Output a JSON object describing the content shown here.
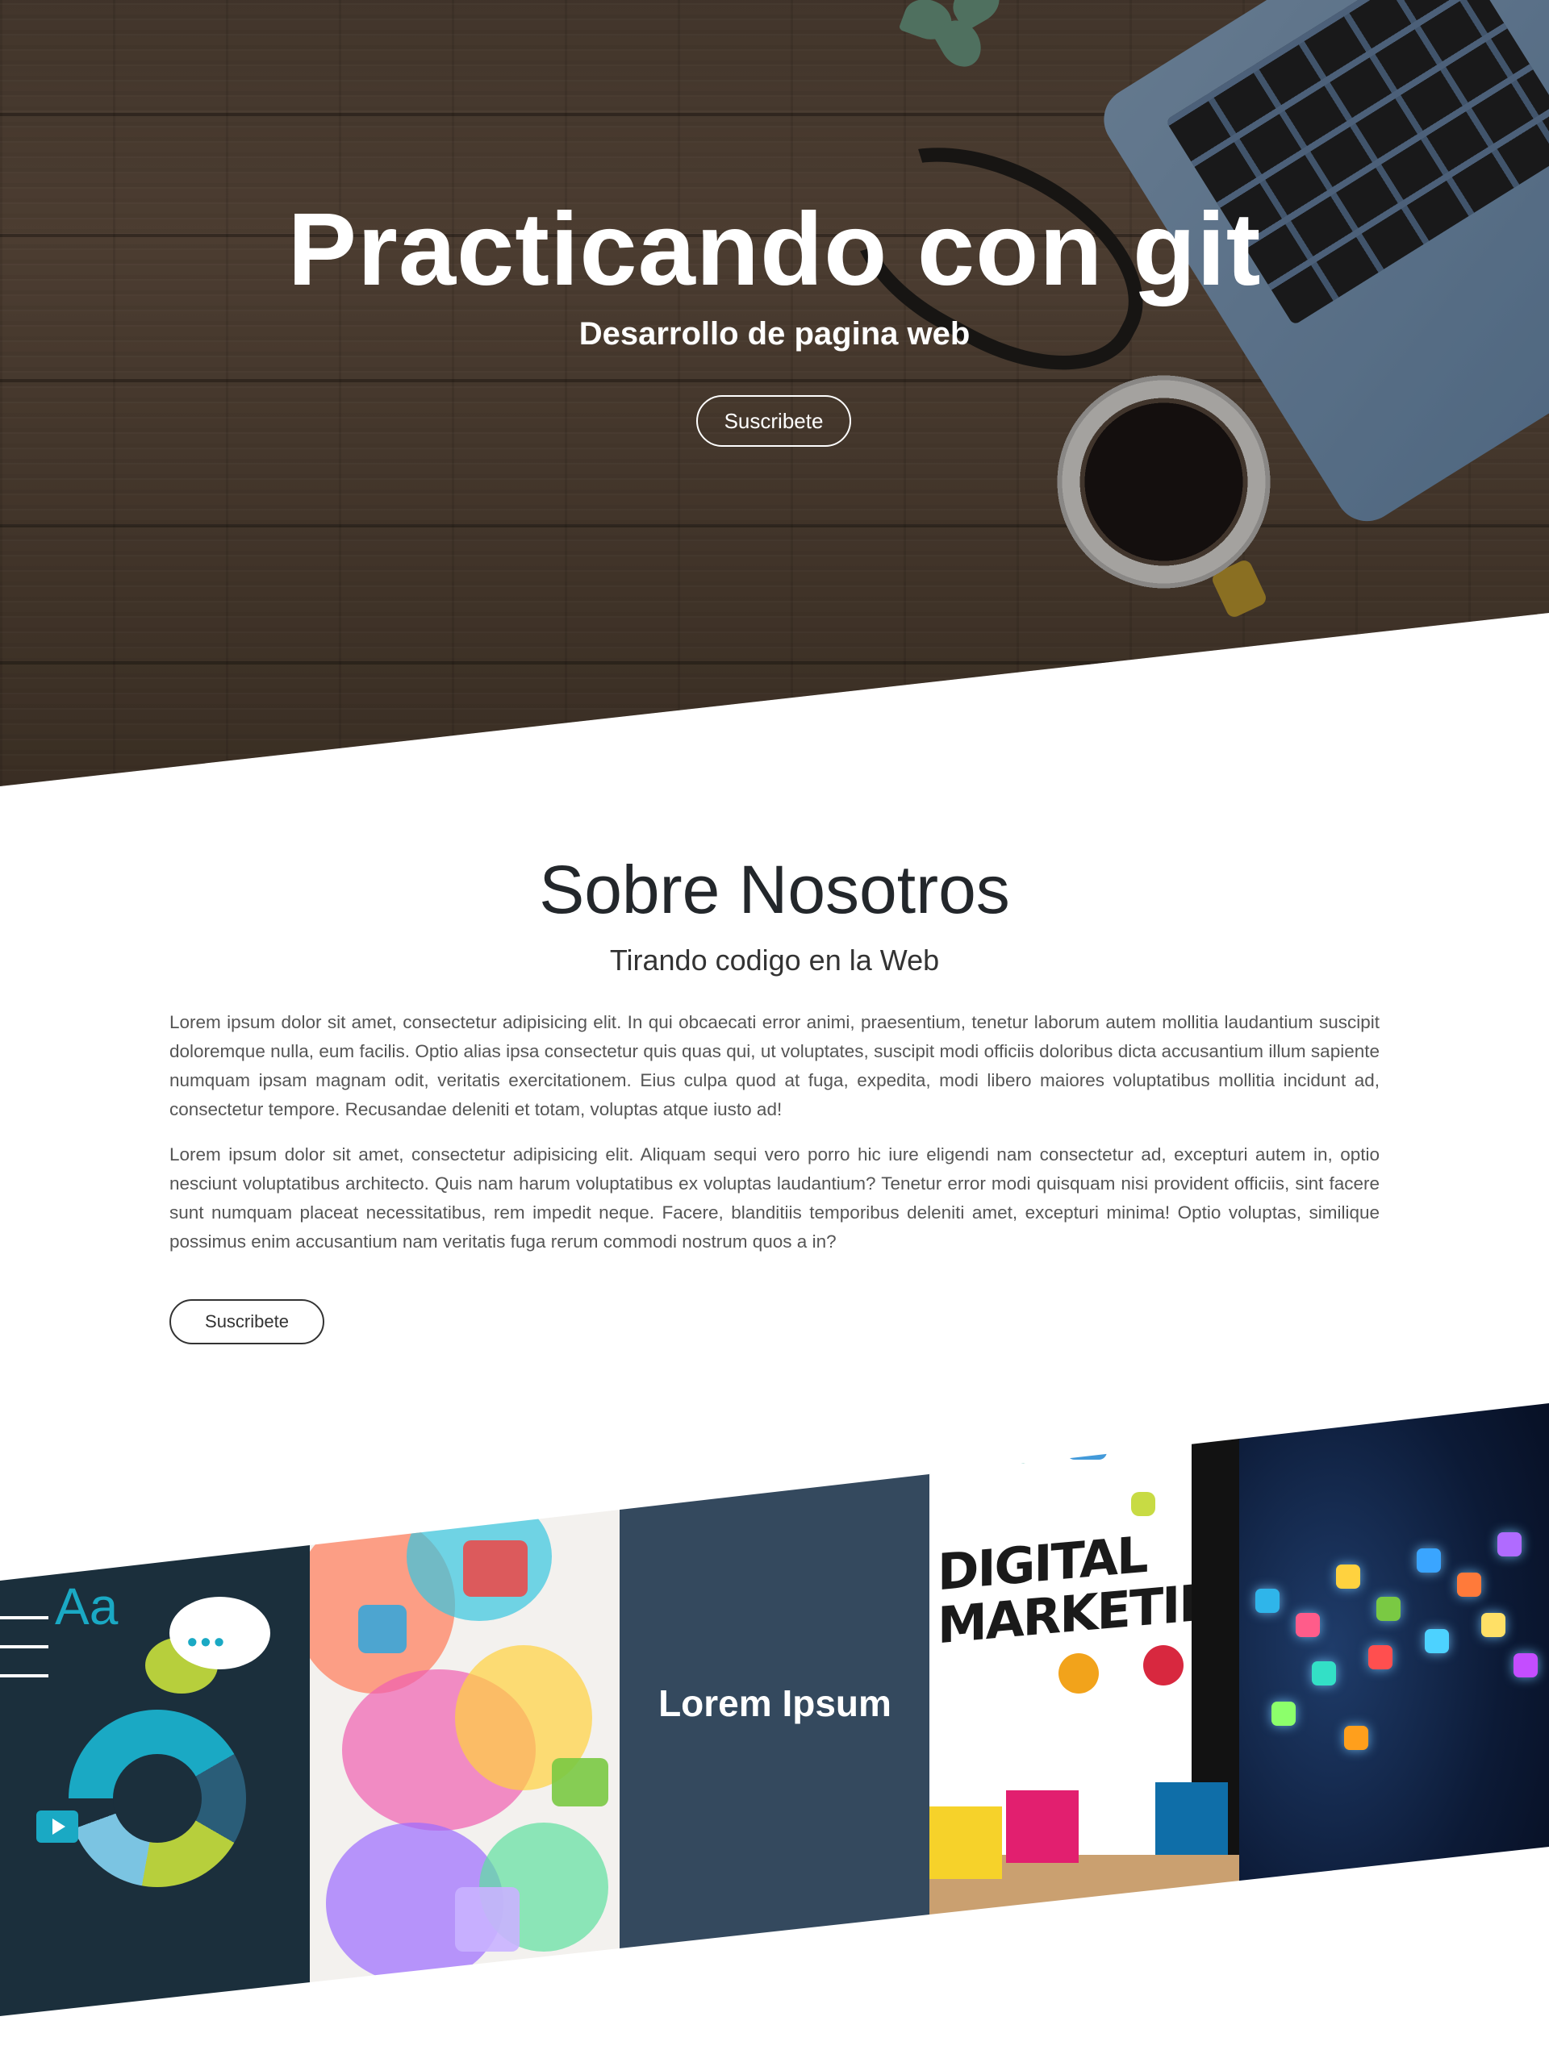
{
  "hero": {
    "title": "Practicando con git",
    "subtitle": "Desarrollo de pagina web",
    "button_label": "Suscribete"
  },
  "about": {
    "title": "Sobre Nosotros",
    "subtitle": "Tirando codigo en la Web",
    "paragraph1": "Lorem ipsum dolor sit amet, consectetur adipisicing elit. In qui obcaecati error animi, praesentium, tenetur laborum autem mollitia laudantium suscipit doloremque nulla, eum facilis. Optio alias ipsa consectetur quis quas qui, ut voluptates, suscipit modi officiis doloribus dicta accusantium illum sapiente numquam ipsam magnam odit, veritatis exercitationem. Eius culpa quod at fuga, expedita, modi libero maiores voluptatibus mollitia incidunt ad, consectetur tempore. Recusandae deleniti et totam, voluptas atque iusto ad!",
    "paragraph2": "Lorem ipsum dolor sit amet, consectetur adipisicing elit. Aliquam sequi vero porro hic iure eligendi nam consectetur ad, excepturi autem in, optio nesciunt voluptatibus architecto. Quis nam harum voluptatibus ex voluptas laudantium? Tenetur error modi quisquam nisi provident officiis, sint facere sunt numquam placeat necessitatibus, rem impedit neque. Facere, blanditiis temporibus deleniti amet, excepturi minima! Optio voluptas, similique possimus enim accusantium nam veritatis fuga rerum commodi nostrum quos a in?",
    "button_label": "Suscribete"
  },
  "gallery": {
    "center_label": "Lorem Ipsum",
    "panel_images": [
      "social-media-icons",
      "colorful-marketing-sketch",
      "digital-marketing-monitor",
      "floating-app-icons"
    ],
    "digital_marketing_line1": "DIGITAL",
    "digital_marketing_line2": "MARKETING",
    "aa_glyph": "Aa",
    "chat_dots": "•••"
  },
  "colors": {
    "center_panel": "#34495e",
    "hero_text": "#ffffff",
    "heading_text": "#23272b"
  }
}
